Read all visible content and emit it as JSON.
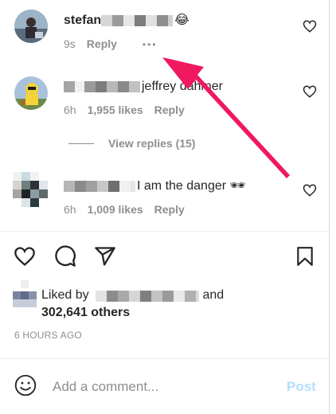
{
  "comments": [
    {
      "username": "stefan",
      "text": "",
      "emoji": "😂",
      "time": "9s",
      "reply_label": "Reply",
      "more_label": "•••"
    },
    {
      "username": "",
      "text": "jeffrey dahmer",
      "time": "6h",
      "likes": "1,955 likes",
      "reply_label": "Reply"
    },
    {
      "username": "",
      "text": "I am the danger",
      "emoji": "🕶",
      "time": "6h",
      "likes": "1,009 likes",
      "reply_label": "Reply"
    }
  ],
  "view_replies_label": "View replies (15)",
  "likes": {
    "prefix": "Liked by",
    "suffix": "and",
    "others": "302,641 others"
  },
  "time_ago": "6 HOURS AGO",
  "add_comment": {
    "placeholder": "Add a comment...",
    "post_label": "Post"
  },
  "colors": {
    "annotation_arrow": "#f0185e",
    "post_disabled": "#b2dffc",
    "secondary_text": "#8e8e8e"
  }
}
